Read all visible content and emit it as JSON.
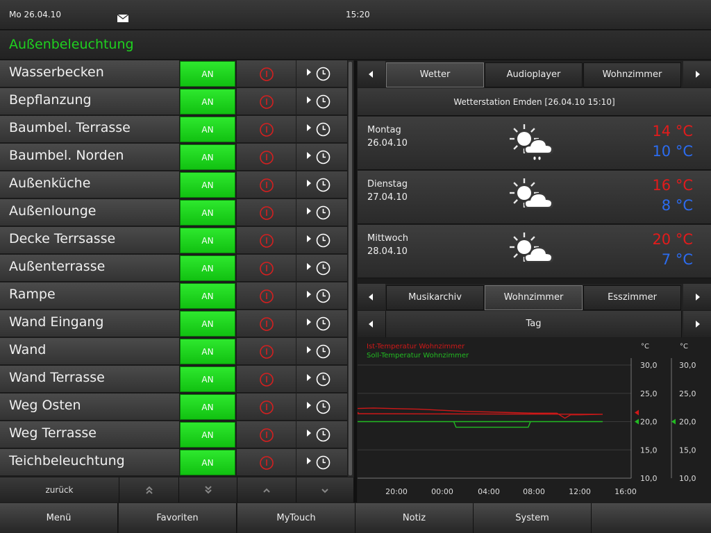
{
  "status": {
    "date": "Mo 26.04.10",
    "time": "15:20",
    "mail_icon": "mail-icon"
  },
  "page": {
    "title": "Außenbeleuchtung"
  },
  "lights": [
    {
      "name": "Wasserbecken",
      "state": "AN"
    },
    {
      "name": "Bepflanzung",
      "state": "AN"
    },
    {
      "name": "Baumbel. Terrasse",
      "state": "AN"
    },
    {
      "name": "Baumbel. Norden",
      "state": "AN"
    },
    {
      "name": "Außenküche",
      "state": "AN"
    },
    {
      "name": "Außenlounge",
      "state": "AN"
    },
    {
      "name": "Decke Terrsasse",
      "state": "AN"
    },
    {
      "name": "Außenterrasse",
      "state": "AN"
    },
    {
      "name": "Rampe",
      "state": "AN"
    },
    {
      "name": "Wand Eingang",
      "state": "AN"
    },
    {
      "name": "Wand",
      "state": "AN"
    },
    {
      "name": "Wand Terrasse",
      "state": "AN"
    },
    {
      "name": "Weg Osten",
      "state": "AN"
    },
    {
      "name": "Weg Terrasse",
      "state": "AN"
    },
    {
      "name": "Teichbeleuchtung",
      "state": "AN"
    }
  ],
  "list_nav": {
    "back_label": "zurück"
  },
  "footer": {
    "items": [
      "Menü",
      "Favoriten",
      "MyTouch",
      "Notiz",
      "System"
    ]
  },
  "top_tabs": {
    "items": [
      "Wetter",
      "Audioplayer",
      "Wohnzimmer"
    ],
    "active": 0
  },
  "weather": {
    "header": "Wetterstation Emden  [26.04.10 15:10]",
    "days": [
      {
        "name": "Montag",
        "date": "26.04.10",
        "high": "14 °C",
        "low": "10 °C",
        "icon": "sun-cloud-rain-icon"
      },
      {
        "name": "Dienstag",
        "date": "27.04.10",
        "high": "16 °C",
        "low": "8 °C",
        "icon": "sun-cloud-icon"
      },
      {
        "name": "Mittwoch",
        "date": "28.04.10",
        "high": "20 °C",
        "low": "7 °C",
        "icon": "sun-cloud-icon"
      }
    ]
  },
  "bottom_tabs": {
    "items": [
      "Musikarchiv",
      "Wohnzimmer",
      "Esszimmer"
    ],
    "active": 1
  },
  "period": {
    "label": "Tag"
  },
  "colors": {
    "accent_green": "#1fd11f",
    "hot": "#e31b1b",
    "cold": "#2b6cf0"
  },
  "chart_data": {
    "type": "line",
    "unit_left": "°C",
    "unit_right": "°C",
    "ylim": [
      10,
      30
    ],
    "y_ticks": [
      "30,0",
      "25,0",
      "20,0",
      "15,0",
      "10,0"
    ],
    "x_ticks": [
      "20:00",
      "00:00",
      "04:00",
      "08:00",
      "12:00",
      "16:00"
    ],
    "grid": true,
    "legend_position": "top-left",
    "series": [
      {
        "name": "Ist-Temperatur Wohnzimmer",
        "color": "#d01818",
        "x": [
          15.0,
          16.0,
          18.0,
          20.0,
          22.0,
          0.0,
          2.0,
          4.0,
          6.0,
          8.0,
          10.0,
          10.7,
          11.2,
          12.0,
          14.0,
          16.0,
          16.7
        ],
        "y": [
          22.2,
          22.3,
          22.4,
          22.3,
          22.2,
          22.0,
          21.8,
          21.7,
          21.6,
          21.5,
          21.5,
          20.6,
          21.2,
          21.2,
          21.3,
          21.4,
          21.6
        ]
      },
      {
        "name": "Soll-Temperatur Wohnzimmer",
        "color": "#22bb22",
        "x": [
          15.0,
          18.0,
          22.0,
          0.0,
          1.0,
          1.2,
          4.0,
          6.0,
          7.5,
          7.7,
          10.0,
          12.0,
          14.0,
          16.7
        ],
        "y": [
          20.0,
          20.0,
          20.0,
          20.0,
          20.0,
          19.0,
          19.0,
          19.0,
          19.0,
          20.0,
          20.0,
          20.0,
          20.0,
          20.0
        ]
      }
    ]
  }
}
